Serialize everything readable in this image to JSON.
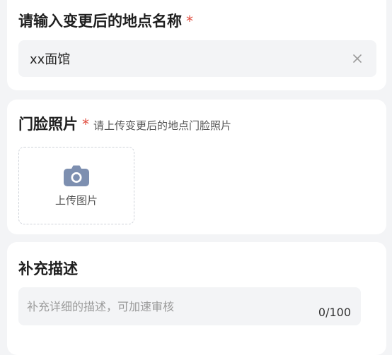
{
  "location_name": {
    "title": "请输入变更后的地点名称",
    "required_mark": "*",
    "value": "xx面馆",
    "clear_icon": "close-icon"
  },
  "storefront_photo": {
    "title": "门脸照片",
    "required_mark": "*",
    "hint": "请上传变更后的地点门脸照片",
    "upload_label": "上传图片",
    "upload_icon": "camera-icon"
  },
  "supplement": {
    "title": "补充描述",
    "placeholder": "补充详细的描述，可加速审核",
    "count": "0/100"
  },
  "colors": {
    "page_bg": "#f3f4f6",
    "card_bg": "#ffffff",
    "required": "#e04b3d",
    "camera_icon": "#7d8fb0"
  }
}
